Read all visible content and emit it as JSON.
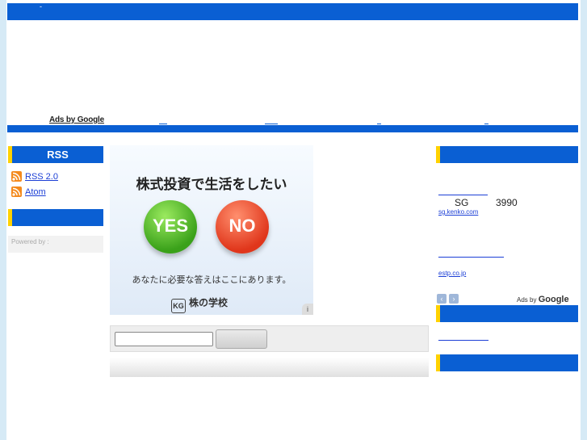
{
  "header": {
    "dash": "-"
  },
  "ads": {
    "ads_by_google": "Ads by Google",
    "sidebar_ad1_title": "SG",
    "sidebar_ad1_price": "3990",
    "sidebar_ad1_url": "sg.kenko.com",
    "sidebar_ad2_url": "estp.co.jp",
    "google_ads_prefix": "Ads by",
    "google_ads_brand": "Google",
    "prev": "‹",
    "next": "›"
  },
  "rss": {
    "title": "RSS",
    "items": [
      {
        "label": "RSS 2.0",
        "icon": "rss-feed-icon"
      },
      {
        "label": "Atom",
        "icon": "rss-feed-icon"
      }
    ]
  },
  "powered": {
    "label": "Powered by :"
  },
  "banner": {
    "headline": "株式投資で生活をしたい",
    "yes": "YES",
    "no": "NO",
    "subtext": "あなたに必要な答えはここにあります。",
    "logo_mark": "KG",
    "logo_text": "株の学校",
    "info": "i"
  },
  "colors": {
    "accent": "#0a5fd3",
    "marker": "#ffd200",
    "background": "#d6eaf6"
  }
}
